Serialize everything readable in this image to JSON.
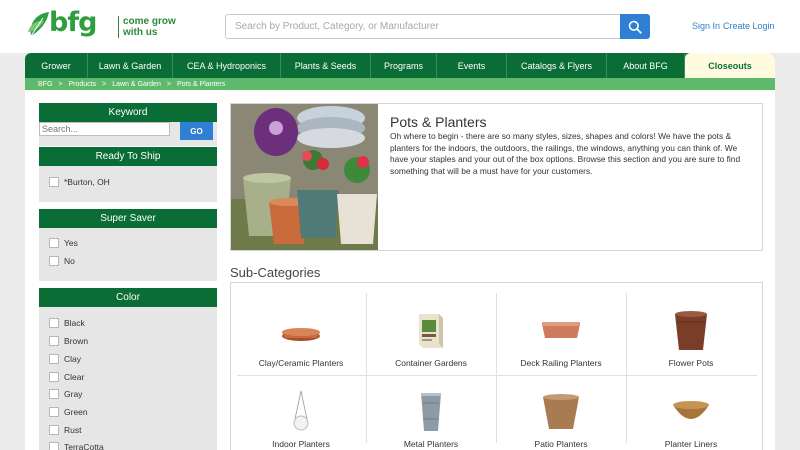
{
  "header": {
    "logo_text": "bfg",
    "tagline_line1": "come grow",
    "tagline_line2": "with us",
    "search_placeholder": "Search by Product, Category, or Manufacturer",
    "sign_in": "Sign In",
    "create_login": "Create Login"
  },
  "nav": {
    "items": [
      "Grower",
      "Lawn & Garden",
      "CEA & Hydroponics",
      "Plants & Seeds",
      "Programs",
      "Events",
      "Catalogs & Flyers",
      "About BFG",
      "Closeouts"
    ]
  },
  "breadcrumb": [
    "BFG",
    "Products",
    "Lawn & Garden",
    "Pots & Planters"
  ],
  "breadcrumb_separator": ">",
  "sidebar": {
    "keyword": {
      "title": "Keyword",
      "placeholder": "Search...",
      "go": "GO"
    },
    "ready_to_ship": {
      "title": "Ready To Ship",
      "options": [
        "*Burton, OH"
      ]
    },
    "super_saver": {
      "title": "Super Saver",
      "options": [
        "Yes",
        "No"
      ]
    },
    "color": {
      "title": "Color",
      "options": [
        "Black",
        "Brown",
        "Clay",
        "Clear",
        "Gray",
        "Green",
        "Rust",
        "TerraCotta"
      ]
    }
  },
  "category": {
    "title": "Pots & Planters",
    "description": "Oh where to begin - there are so many styles, sizes, shapes and colors! We have the pots & planters for the indoors, the outdoors, the railings, the windows, anything you can think of. We have your staples and your out of the box options. Browse this section and you are sure to find something that will be a must have for your customers."
  },
  "subcategories": {
    "title": "Sub-Categories",
    "items": [
      "Clay/Ceramic Planters",
      "Container Gardens",
      "Deck Railing Planters",
      "Flower Pots",
      "Indoor Planters",
      "Metal Planters",
      "Patio Planters",
      "Planter Liners"
    ]
  },
  "colors": {
    "brand_green": "#0b6d36",
    "crumb_green": "#5fb96a",
    "accent_blue": "#2f80d4"
  }
}
